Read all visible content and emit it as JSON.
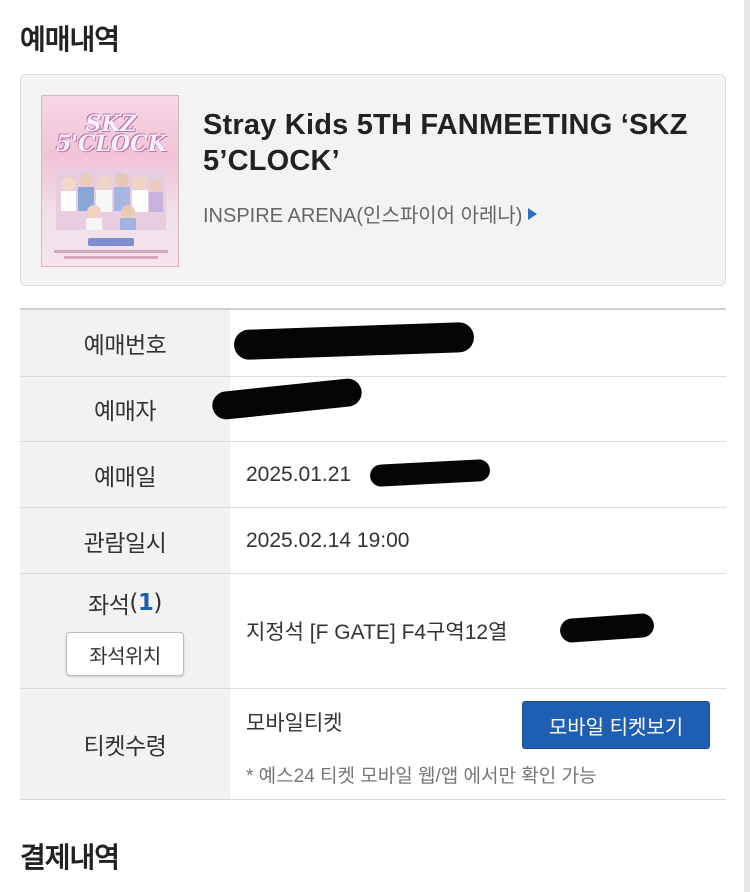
{
  "sections": {
    "booking_title": "예매내역",
    "payment_title": "결제내역"
  },
  "event": {
    "title": "Stray Kids 5TH FANMEETING ‘SKZ 5’CLOCK’",
    "venue": "INSPIRE ARENA(인스파이어 아레나)",
    "poster_logo": "SKZ 5'CLOCK"
  },
  "table": {
    "booking_number_label": "예매번호",
    "booker_label": "예매자",
    "booking_date_label": "예매일",
    "booking_date_value": "2025.01.21",
    "view_datetime_label": "관람일시",
    "view_datetime_value": "2025.02.14 19:00",
    "seat_label": "좌석",
    "seat_count": "1",
    "seat_location_button": "좌석위치",
    "seat_value": "지정석 [F GATE] F4구역12열",
    "ticket_receipt_label": "티켓수령",
    "ticket_receipt_value": "모바일티켓",
    "mobile_ticket_button": "모바일 티켓보기",
    "ticket_note": "* 예스24 티켓 모바일 웹/앱 에서만 확인 가능"
  },
  "colors": {
    "accent": "#1f5fb2",
    "label_bg": "#f2f2f2",
    "card_bg": "#f3f3f3"
  },
  "icons": {
    "venue_link": "triangle-right-icon"
  }
}
